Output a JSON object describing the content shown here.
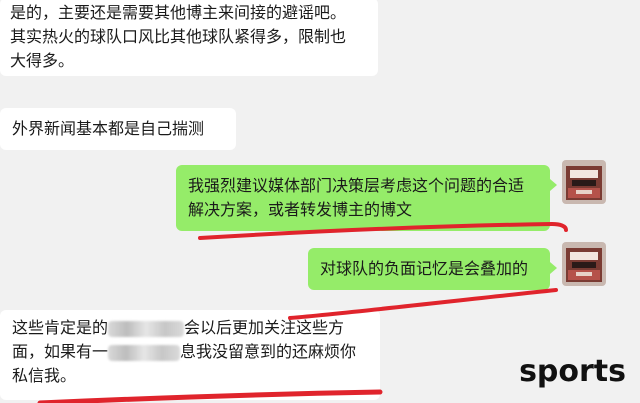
{
  "messages": [
    {
      "id": "m1",
      "side": "left",
      "lines": [
        "是的，主要还是需要其他博主来间接的避谣吧。",
        "其实热火的球队口风比其他球队紧得多，限制也",
        "大得多。"
      ]
    },
    {
      "id": "m2",
      "side": "left",
      "lines": [
        "外界新闻基本都是自己揣测"
      ]
    },
    {
      "id": "m3",
      "side": "right",
      "lines": [
        "我强烈建议媒体部门决策层考虑这个问题的合适",
        "解决方案，或者转发博主的博文"
      ]
    },
    {
      "id": "m4",
      "side": "right",
      "lines": [
        "对球队的负面记忆是会叠加的"
      ]
    },
    {
      "id": "m5",
      "side": "left",
      "line1_prefix": "这些肯定是的",
      "line1_suffix": "会以后更加关注这些方",
      "line2_prefix": "面，如果有一",
      "line2_suffix": "息我没留意到的还麻烦你",
      "line3": "私信我。"
    }
  ],
  "watermark": "sports",
  "colors": {
    "outgoing_bubble": "#95ec69",
    "incoming_bubble": "#ffffff",
    "background": "#f1f1f1",
    "underline": "#e0242c"
  }
}
